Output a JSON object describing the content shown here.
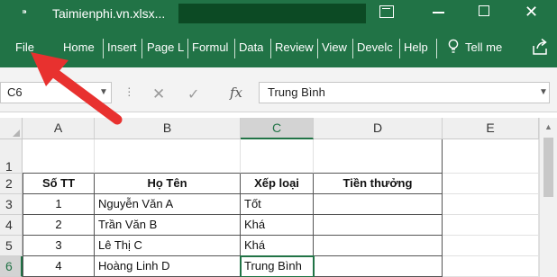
{
  "window": {
    "title": "Taimienphi.vn.xlsx...",
    "icons": [
      "pin-icon",
      "ribbon-display-icon",
      "minimize-icon",
      "maximize-icon",
      "close-icon"
    ]
  },
  "ribbon": {
    "tabs": [
      "File",
      "Home",
      "Insert",
      "Page L",
      "Formul",
      "Data",
      "Review",
      "View",
      "Develc",
      "Help"
    ],
    "tell_me": "Tell me",
    "accent_color": "#217346"
  },
  "formula_bar": {
    "name_box": "C6",
    "formula": "Trung Bình"
  },
  "sheet": {
    "columns": [
      "A",
      "B",
      "C",
      "D",
      "E"
    ],
    "selected_column": "C",
    "rows": [
      {
        "num": "1",
        "cells": [
          "",
          "",
          "",
          ""
        ]
      },
      {
        "num": "2",
        "cells": [
          "Số TT",
          "Họ Tên",
          "Xếp loại",
          "Tiền thưởng"
        ]
      },
      {
        "num": "3",
        "cells": [
          "1",
          "Nguyễn Văn A",
          "Tốt",
          ""
        ]
      },
      {
        "num": "4",
        "cells": [
          "2",
          "Trần Văn B",
          "Khá",
          ""
        ]
      },
      {
        "num": "5",
        "cells": [
          "3",
          "Lê Thị C",
          "Khá",
          ""
        ]
      },
      {
        "num": "6",
        "cells": [
          "4",
          "Hoàng Linh D",
          "Trung Bình",
          ""
        ]
      }
    ],
    "active_cell": "C6"
  }
}
